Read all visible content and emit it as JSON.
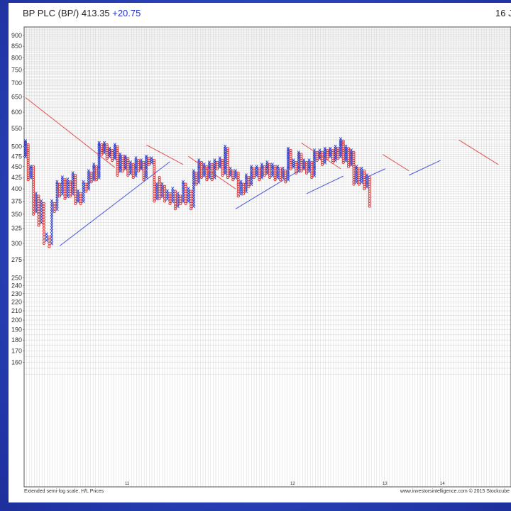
{
  "header": {
    "title": "BP PLC (BP/) 413.35",
    "change": "+20.75",
    "date": "16 J"
  },
  "footer": {
    "scale_note": "Extended semi-log scale, H/L Prices",
    "credit": "www.investorsintelligence.com   © 2015 Stockcube"
  },
  "colors": {
    "x_color": "#2233cc",
    "o_color": "#dd3333",
    "grid_color": "#d4d4d4",
    "resistance_color": "#e05050",
    "support_color": "#4a5ad8"
  },
  "chart_data": {
    "type": "point-and-figure",
    "symbol_x": "X",
    "symbol_o": "O",
    "y_scale": "semi-log",
    "y_ticks": [
      900,
      850,
      800,
      750,
      700,
      650,
      600,
      550,
      500,
      475,
      450,
      425,
      400,
      375,
      350,
      325,
      300,
      275,
      250,
      240,
      230,
      220,
      210,
      200,
      190,
      180,
      170,
      160
    ],
    "x_labels": [
      "11",
      "12",
      "13",
      "14"
    ],
    "columns": [
      {
        "t": "X",
        "lo": 475,
        "hi": 515
      },
      {
        "t": "O",
        "lo": 420,
        "hi": 505
      },
      {
        "t": "X",
        "lo": 425,
        "hi": 450
      },
      {
        "t": "O",
        "lo": 350,
        "hi": 450
      },
      {
        "t": "X",
        "lo": 355,
        "hi": 390
      },
      {
        "t": "O",
        "lo": 330,
        "hi": 385
      },
      {
        "t": "X",
        "lo": 335,
        "hi": 375
      },
      {
        "t": "O",
        "lo": 300,
        "hi": 370
      },
      {
        "t": "X",
        "lo": 305,
        "hi": 315
      },
      {
        "t": "O",
        "lo": 295,
        "hi": 310
      },
      {
        "t": "X",
        "lo": 300,
        "hi": 375
      },
      {
        "t": "O",
        "lo": 355,
        "hi": 370
      },
      {
        "t": "X",
        "lo": 360,
        "hi": 415
      },
      {
        "t": "O",
        "lo": 385,
        "hi": 410
      },
      {
        "t": "X",
        "lo": 390,
        "hi": 425
      },
      {
        "t": "O",
        "lo": 380,
        "hi": 420
      },
      {
        "t": "X",
        "lo": 385,
        "hi": 420
      },
      {
        "t": "O",
        "lo": 385,
        "hi": 415
      },
      {
        "t": "X",
        "lo": 390,
        "hi": 435
      },
      {
        "t": "O",
        "lo": 370,
        "hi": 430
      },
      {
        "t": "X",
        "lo": 375,
        "hi": 395
      },
      {
        "t": "O",
        "lo": 370,
        "hi": 390
      },
      {
        "t": "X",
        "lo": 375,
        "hi": 415
      },
      {
        "t": "O",
        "lo": 395,
        "hi": 410
      },
      {
        "t": "X",
        "lo": 400,
        "hi": 440
      },
      {
        "t": "O",
        "lo": 415,
        "hi": 435
      },
      {
        "t": "X",
        "lo": 420,
        "hi": 455
      },
      {
        "t": "O",
        "lo": 420,
        "hi": 450
      },
      {
        "t": "X",
        "lo": 425,
        "hi": 510
      },
      {
        "t": "O",
        "lo": 480,
        "hi": 505
      },
      {
        "t": "X",
        "lo": 485,
        "hi": 510
      },
      {
        "t": "O",
        "lo": 470,
        "hi": 505
      },
      {
        "t": "X",
        "lo": 475,
        "hi": 495
      },
      {
        "t": "O",
        "lo": 465,
        "hi": 490
      },
      {
        "t": "X",
        "lo": 470,
        "hi": 505
      },
      {
        "t": "O",
        "lo": 430,
        "hi": 500
      },
      {
        "t": "X",
        "lo": 440,
        "hi": 480
      },
      {
        "t": "O",
        "lo": 440,
        "hi": 475
      },
      {
        "t": "X",
        "lo": 445,
        "hi": 475
      },
      {
        "t": "O",
        "lo": 430,
        "hi": 470
      },
      {
        "t": "X",
        "lo": 435,
        "hi": 460
      },
      {
        "t": "O",
        "lo": 425,
        "hi": 455
      },
      {
        "t": "X",
        "lo": 430,
        "hi": 470
      },
      {
        "t": "O",
        "lo": 440,
        "hi": 465
      },
      {
        "t": "X",
        "lo": 445,
        "hi": 465
      },
      {
        "t": "O",
        "lo": 420,
        "hi": 460
      },
      {
        "t": "X",
        "lo": 425,
        "hi": 475
      },
      {
        "t": "O",
        "lo": 455,
        "hi": 470
      },
      {
        "t": "X",
        "lo": 460,
        "hi": 470
      },
      {
        "t": "O",
        "lo": 375,
        "hi": 465
      },
      {
        "t": "X",
        "lo": 380,
        "hi": 410
      },
      {
        "t": "O",
        "lo": 380,
        "hi": 425
      },
      {
        "t": "X",
        "lo": 385,
        "hi": 410
      },
      {
        "t": "O",
        "lo": 375,
        "hi": 405
      },
      {
        "t": "X",
        "lo": 380,
        "hi": 395
      },
      {
        "t": "O",
        "lo": 370,
        "hi": 390
      },
      {
        "t": "X",
        "lo": 375,
        "hi": 400
      },
      {
        "t": "O",
        "lo": 360,
        "hi": 395
      },
      {
        "t": "X",
        "lo": 365,
        "hi": 390
      },
      {
        "t": "O",
        "lo": 370,
        "hi": 385
      },
      {
        "t": "X",
        "lo": 375,
        "hi": 415
      },
      {
        "t": "O",
        "lo": 370,
        "hi": 410
      },
      {
        "t": "X",
        "lo": 375,
        "hi": 400
      },
      {
        "t": "O",
        "lo": 360,
        "hi": 395
      },
      {
        "t": "X",
        "lo": 365,
        "hi": 440
      },
      {
        "t": "O",
        "lo": 410,
        "hi": 435
      },
      {
        "t": "X",
        "lo": 415,
        "hi": 465
      },
      {
        "t": "O",
        "lo": 425,
        "hi": 460
      },
      {
        "t": "X",
        "lo": 430,
        "hi": 455
      },
      {
        "t": "O",
        "lo": 420,
        "hi": 450
      },
      {
        "t": "X",
        "lo": 425,
        "hi": 460
      },
      {
        "t": "O",
        "lo": 420,
        "hi": 455
      },
      {
        "t": "X",
        "lo": 425,
        "hi": 465
      },
      {
        "t": "O",
        "lo": 445,
        "hi": 460
      },
      {
        "t": "X",
        "lo": 450,
        "hi": 470
      },
      {
        "t": "O",
        "lo": 430,
        "hi": 465
      },
      {
        "t": "X",
        "lo": 435,
        "hi": 500
      },
      {
        "t": "O",
        "lo": 425,
        "hi": 495
      },
      {
        "t": "X",
        "lo": 430,
        "hi": 445
      },
      {
        "t": "O",
        "lo": 420,
        "hi": 440
      },
      {
        "t": "X",
        "lo": 425,
        "hi": 440
      },
      {
        "t": "O",
        "lo": 385,
        "hi": 435
      },
      {
        "t": "X",
        "lo": 390,
        "hi": 415
      },
      {
        "t": "O",
        "lo": 390,
        "hi": 410
      },
      {
        "t": "X",
        "lo": 395,
        "hi": 430
      },
      {
        "t": "O",
        "lo": 405,
        "hi": 425
      },
      {
        "t": "X",
        "lo": 410,
        "hi": 450
      },
      {
        "t": "O",
        "lo": 425,
        "hi": 445
      },
      {
        "t": "X",
        "lo": 430,
        "hi": 450
      },
      {
        "t": "O",
        "lo": 420,
        "hi": 445
      },
      {
        "t": "X",
        "lo": 425,
        "hi": 455
      },
      {
        "t": "O",
        "lo": 430,
        "hi": 450
      },
      {
        "t": "X",
        "lo": 435,
        "hi": 460
      },
      {
        "t": "O",
        "lo": 425,
        "hi": 455
      },
      {
        "t": "X",
        "lo": 430,
        "hi": 455
      },
      {
        "t": "O",
        "lo": 420,
        "hi": 450
      },
      {
        "t": "X",
        "lo": 425,
        "hi": 450
      },
      {
        "t": "O",
        "lo": 420,
        "hi": 445
      },
      {
        "t": "X",
        "lo": 425,
        "hi": 445
      },
      {
        "t": "O",
        "lo": 415,
        "hi": 440
      },
      {
        "t": "X",
        "lo": 420,
        "hi": 495
      },
      {
        "t": "O",
        "lo": 445,
        "hi": 490
      },
      {
        "t": "X",
        "lo": 450,
        "hi": 465
      },
      {
        "t": "O",
        "lo": 435,
        "hi": 460
      },
      {
        "t": "X",
        "lo": 440,
        "hi": 485
      },
      {
        "t": "O",
        "lo": 440,
        "hi": 480
      },
      {
        "t": "X",
        "lo": 445,
        "hi": 465
      },
      {
        "t": "O",
        "lo": 435,
        "hi": 460
      },
      {
        "t": "X",
        "lo": 440,
        "hi": 465
      },
      {
        "t": "O",
        "lo": 425,
        "hi": 460
      },
      {
        "t": "X",
        "lo": 430,
        "hi": 490
      },
      {
        "t": "O",
        "lo": 465,
        "hi": 485
      },
      {
        "t": "X",
        "lo": 470,
        "hi": 490
      },
      {
        "t": "O",
        "lo": 455,
        "hi": 485
      },
      {
        "t": "X",
        "lo": 460,
        "hi": 495
      },
      {
        "t": "O",
        "lo": 470,
        "hi": 490
      },
      {
        "t": "X",
        "lo": 475,
        "hi": 495
      },
      {
        "t": "O",
        "lo": 460,
        "hi": 490
      },
      {
        "t": "X",
        "lo": 465,
        "hi": 500
      },
      {
        "t": "O",
        "lo": 470,
        "hi": 495
      },
      {
        "t": "X",
        "lo": 475,
        "hi": 520
      },
      {
        "t": "O",
        "lo": 460,
        "hi": 515
      },
      {
        "t": "X",
        "lo": 465,
        "hi": 500
      },
      {
        "t": "O",
        "lo": 450,
        "hi": 495
      },
      {
        "t": "X",
        "lo": 455,
        "hi": 490
      },
      {
        "t": "O",
        "lo": 410,
        "hi": 485
      },
      {
        "t": "X",
        "lo": 415,
        "hi": 450
      },
      {
        "t": "O",
        "lo": 410,
        "hi": 445
      },
      {
        "t": "X",
        "lo": 415,
        "hi": 445
      },
      {
        "t": "O",
        "lo": 400,
        "hi": 440
      },
      {
        "t": "X",
        "lo": 405,
        "hi": 430
      },
      {
        "t": "O",
        "lo": 365,
        "hi": 425
      }
    ],
    "trend_lines": [
      {
        "kind": "resistance",
        "x1": 0,
        "y1": 648,
        "x2": 34,
        "y2": 448
      },
      {
        "kind": "support",
        "x1": 13,
        "y1": 296,
        "x2": 55,
        "y2": 462
      },
      {
        "kind": "resistance",
        "x1": 46,
        "y1": 505,
        "x2": 60,
        "y2": 455
      },
      {
        "kind": "resistance",
        "x1": 62,
        "y1": 475,
        "x2": 80,
        "y2": 400
      },
      {
        "kind": "support",
        "x1": 80,
        "y1": 360,
        "x2": 104,
        "y2": 440
      },
      {
        "kind": "resistance",
        "x1": 105,
        "y1": 510,
        "x2": 120,
        "y2": 445
      },
      {
        "kind": "support",
        "x1": 107,
        "y1": 390,
        "x2": 121,
        "y2": 428
      },
      {
        "kind": "support",
        "x1": 126,
        "y1": 415,
        "x2": 137,
        "y2": 445
      },
      {
        "kind": "resistance",
        "x1": 136,
        "y1": 480,
        "x2": 146,
        "y2": 440
      },
      {
        "kind": "support",
        "x1": 146,
        "y1": 430,
        "x2": 158,
        "y2": 465
      },
      {
        "kind": "resistance",
        "x1": 165,
        "y1": 518,
        "x2": 180,
        "y2": 455
      }
    ]
  }
}
